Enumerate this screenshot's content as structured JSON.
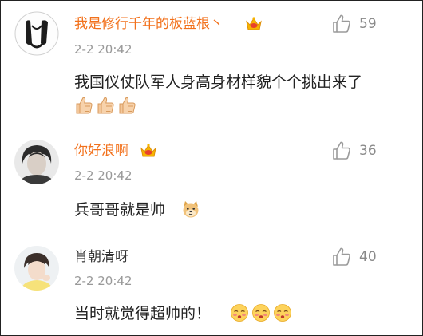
{
  "comments": [
    {
      "username": "我是修行千年的板蓝根丶",
      "username_color": "#f2711c",
      "vip_badge": "crown-vip-icon",
      "time": "2-2 20:42",
      "likes": "59",
      "text": "我国仪仗队军人身高身材样貌个个挑出来了",
      "emoji": "thumbs-up-emoji",
      "emoji_count": 3
    },
    {
      "username": "你好浪啊",
      "username_color": "#f2711c",
      "vip_badge": "crown-vip-icon",
      "time": "2-2 20:42",
      "likes": "36",
      "text": "兵哥哥就是帅",
      "emoji": "doge-emoji",
      "emoji_count": 1
    },
    {
      "username": "肖朝清呀",
      "username_color": "#333333",
      "vip_badge": null,
      "time": "2-2 20:42",
      "likes": "40",
      "text": "当时就觉得超帅的！",
      "emoji": "shy-face-emoji",
      "emoji_count": 3
    }
  ],
  "colors": {
    "username_orange": "#f2711c",
    "meta_grey": "#999999",
    "text": "#222222"
  },
  "icons": {
    "like": "thumbs-up-outline-icon"
  }
}
